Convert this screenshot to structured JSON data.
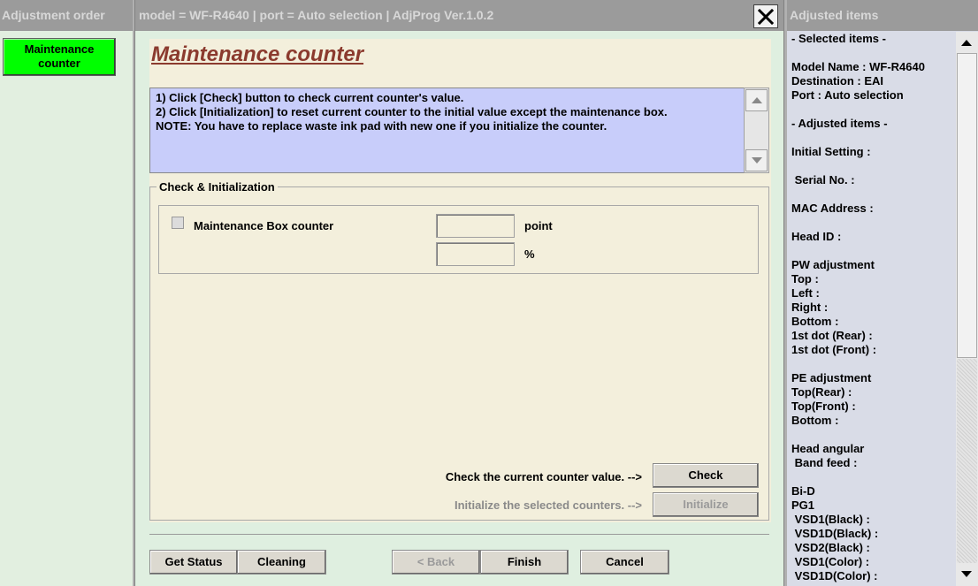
{
  "left_panel": {
    "header": "Adjustment order",
    "item_label": "Maintenance\ncounter",
    "item_color": "#00ff00"
  },
  "center_panel": {
    "header": "model = WF-R4640  |  port = Auto selection  |  AdjProg Ver.1.0.2",
    "title": "Maintenance counter",
    "instructions": [
      "1) Click [Check] button to check current counter's value.",
      "2) Click [Initialization] to reset current counter to the initial value except the maintenance box.",
      "NOTE: You have to replace waste ink pad with new one if you initialize the counter."
    ],
    "group_label": "Check & Initialization",
    "counter": {
      "label": "Maintenance Box counter",
      "checked": false,
      "point_value": "",
      "point_unit": "point",
      "percent_value": "",
      "percent_unit": "%"
    },
    "check_hint": "Check the current counter value.  -->",
    "check_button": "Check",
    "init_hint": "Initialize the selected counters.  -->",
    "init_button": "Initialize",
    "footer_buttons": {
      "get_status": "Get Status",
      "cleaning": "Cleaning",
      "back": "< Back",
      "finish": "Finish",
      "cancel": "Cancel"
    }
  },
  "right_panel": {
    "header": "Adjusted items",
    "lines": [
      "- Selected items -",
      "",
      "Model Name : WF-R4640",
      "Destination : EAI",
      "Port : Auto selection",
      "",
      "- Adjusted items -",
      "",
      "Initial Setting :",
      "",
      " Serial No. :",
      "",
      "MAC Address :",
      "",
      "Head ID :",
      "",
      "PW adjustment",
      "Top :",
      "Left :",
      "Right :",
      "Bottom :",
      "1st dot (Rear) :",
      "1st dot (Front) :",
      "",
      "PE adjustment",
      "Top(Rear) :",
      "Top(Front) :",
      "Bottom :",
      "",
      "Head angular",
      " Band feed :",
      "",
      "Bi-D",
      "PG1",
      " VSD1(Black) :",
      " VSD1D(Black) :",
      " VSD2(Black) :",
      " VSD1(Color) :",
      " VSD1D(Color) :"
    ]
  },
  "colors": {
    "header_bg": "#9b9b9b",
    "title_color": "#8b3a2e",
    "note_bg": "#c8cdfa",
    "content_bg": "#f3efdc",
    "right_bg": "#d9dce7"
  }
}
